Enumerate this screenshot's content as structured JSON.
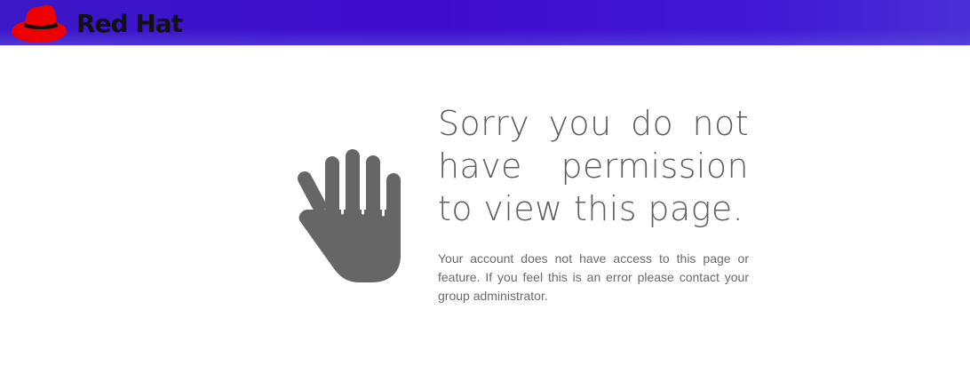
{
  "header": {
    "brand": "Red Hat",
    "logo_icon": "red-hat-fedora-icon",
    "background_color": "#3f0ccd",
    "logo_hat_color": "#ee0000"
  },
  "error": {
    "icon": "stop-hand-icon",
    "icon_color": "#666666",
    "title": "Sorry you do not have permission to view this page.",
    "message": "Your account does not have access to this page or feature. If you feel this is an error please contact your group administrator."
  }
}
